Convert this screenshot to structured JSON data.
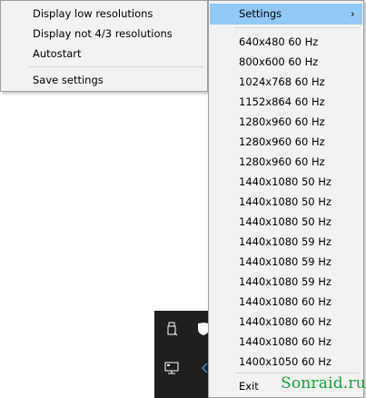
{
  "tray": {
    "icons": [
      "usb-icon",
      "shield-icon",
      "network-icon",
      "speaker-icon"
    ]
  },
  "main_menu": {
    "items": [
      {
        "label": "Display low resolutions"
      },
      {
        "label": "Display not 4/3 resolutions"
      },
      {
        "label": "Autostart"
      }
    ],
    "save_label": "Save settings"
  },
  "submenu": {
    "settings_label": "Settings",
    "chevron_glyph": "›",
    "resolutions": [
      "640x480 60 Hz",
      "800x600 60 Hz",
      "1024x768 60 Hz",
      "1152x864 60 Hz",
      "1280x960 60 Hz",
      "1280x960 60 Hz",
      "1280x960 60 Hz",
      "1440x1080 50 Hz",
      "1440x1080 50 Hz",
      "1440x1080 50 Hz",
      "1440x1080 59 Hz",
      "1440x1080 59 Hz",
      "1440x1080 59 Hz",
      "1440x1080 60 Hz",
      "1440x1080 60 Hz",
      "1440x1080 60 Hz",
      "1400x1050 60 Hz"
    ],
    "exit_label": "Exit"
  },
  "watermark": {
    "text": "Sonraid.ru",
    "color": "#16a43a"
  },
  "colors": {
    "menu_bg": "#f2f2f2",
    "highlight": "#91c9f7",
    "taskbar": "#1f1f1f"
  }
}
